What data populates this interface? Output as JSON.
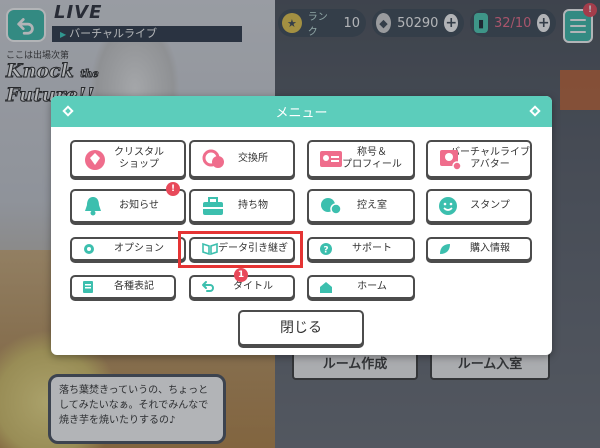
{
  "topbar": {
    "live_title": "LIVE",
    "live_subtitle": "バーチャルライブ",
    "song_small": "ここは出場次第",
    "song_big_line1": "Knock",
    "song_big_mid": "the",
    "song_big_line2": "Future!!",
    "rank_label": "ランク",
    "rank_value": "10",
    "crystal_value": "50290",
    "ticket_value": "32/10",
    "menu_badge": "!"
  },
  "background": {
    "room_create": "ルーム作成",
    "room_join": "ルーム入室",
    "speech": "落ち葉焚きっていうの、ちょっとしてみたいなぁ。それでみんなで焼き芋を焼いたりするの♪"
  },
  "menu": {
    "title": "メニュー",
    "crystal_shop": "クリスタル\nショップ",
    "exchange": "交換所",
    "title_profile": "称号＆\nプロフィール",
    "virtual_avatar": "バーチャルライブ\nアバター",
    "notices": "お知らせ",
    "inventory": "持ち物",
    "dressing_room": "控え室",
    "stamp": "スタンプ",
    "options": "オプション",
    "data_transfer": "データ引き継ぎ",
    "support": "サポート",
    "purchase_info": "購入情報",
    "legal": "各種表記",
    "title_screen": "タイトル",
    "home": "ホーム",
    "notices_badge": "!",
    "title_badge": "1",
    "close": "閉じる"
  },
  "colors": {
    "accent_teal": "#5ccdbb",
    "badge_red": "#e8495a",
    "highlight_red": "#e53434",
    "icon_pink": "#ef6d8c",
    "icon_teal": "#3cbfae"
  }
}
